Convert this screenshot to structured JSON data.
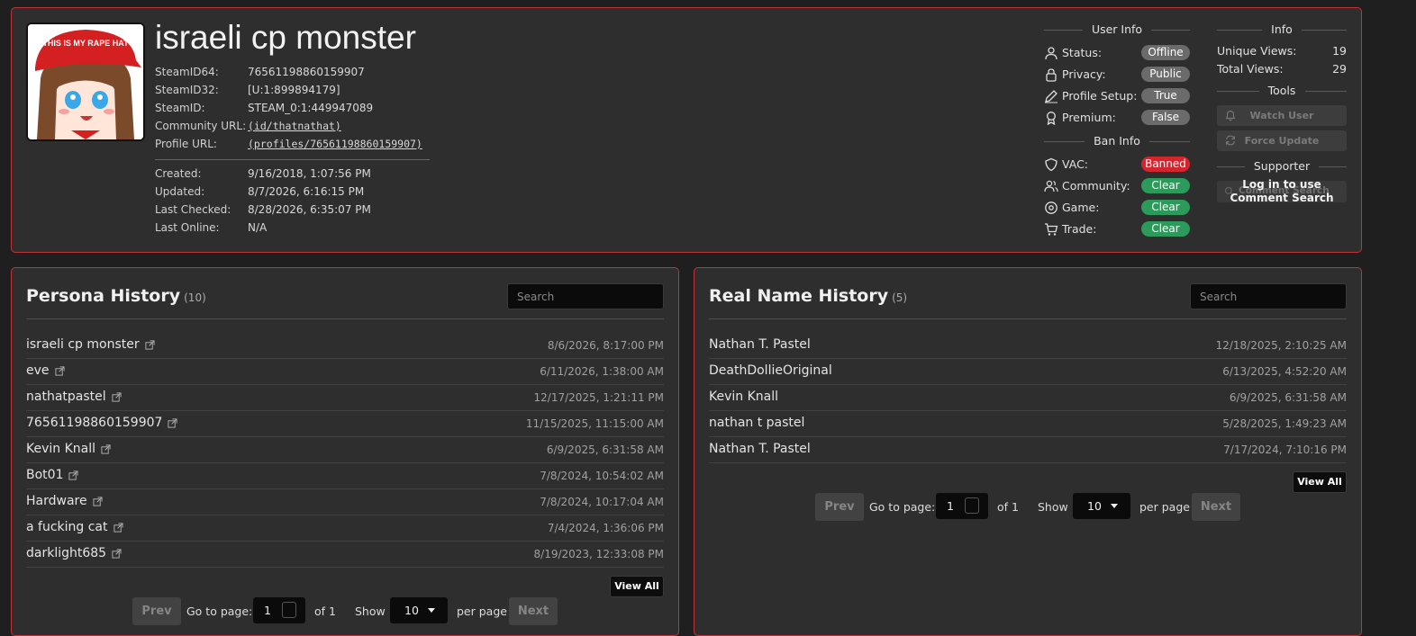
{
  "profile": {
    "name": "israeli cp monster",
    "avatar_text": "THIS IS MY RAPE HAT",
    "fields": [
      {
        "key": "SteamID64:",
        "value": "76561198860159907"
      },
      {
        "key": "SteamID32:",
        "value": "[U:1:899894179]"
      },
      {
        "key": "SteamID:",
        "value": "STEAM_0:1:449947089"
      },
      {
        "key": "Community URL:",
        "value": "(id/thatnathat)"
      },
      {
        "key": "Profile URL:",
        "value": "(profiles/76561198860159907)"
      }
    ],
    "dates": [
      {
        "key": "Created:",
        "value": "9/16/2018, 1:07:56 PM"
      },
      {
        "key": "Updated:",
        "value": "8/7/2026, 6:16:15 PM"
      },
      {
        "key": "Last Checked:",
        "value": "8/28/2026, 6:35:07 PM"
      },
      {
        "key": "Last Online:",
        "value": "N/A"
      }
    ]
  },
  "user_info": {
    "heading": "User Info",
    "rows": [
      {
        "label": "Status:",
        "value": "Offline",
        "icon": "user-icon",
        "color": "#6b6b6b"
      },
      {
        "label": "Privacy:",
        "value": "Public",
        "icon": "lock-icon",
        "color": "#6b6b6b"
      },
      {
        "label": "Profile Setup:",
        "value": "True",
        "icon": "pencil-icon",
        "color": "#6b6b6b"
      },
      {
        "label": "Premium:",
        "value": "False",
        "icon": "award-icon",
        "color": "#6b6b6b"
      }
    ]
  },
  "ban_info": {
    "heading": "Ban Info",
    "rows": [
      {
        "label": "VAC:",
        "value": "Banned",
        "icon": "shield-icon",
        "color": "#d4252e"
      },
      {
        "label": "Community:",
        "value": "Clear",
        "icon": "users-icon",
        "color": "#2b9a5a"
      },
      {
        "label": "Game:",
        "value": "Clear",
        "icon": "disc-icon",
        "color": "#2b9a5a"
      },
      {
        "label": "Trade:",
        "value": "Clear",
        "icon": "cart-icon",
        "color": "#2b9a5a"
      }
    ]
  },
  "info": {
    "heading": "Info",
    "unique_views_label": "Unique Views:",
    "unique_views": "19",
    "total_views_label": "Total Views:",
    "total_views": "29"
  },
  "tools": {
    "heading": "Tools",
    "watch_label": "Watch User",
    "update_label": "Force Update"
  },
  "supporter": {
    "heading": "Supporter",
    "ghost_label": "Comment Search",
    "login_text": "Log in to use Comment Search"
  },
  "persona": {
    "title": "Persona History",
    "count": "(10)",
    "search_placeholder": "Search",
    "rows": [
      {
        "name": "israeli cp monster",
        "date": "8/6/2026, 8:17:00 PM"
      },
      {
        "name": "eve",
        "date": "6/11/2026, 1:38:00 AM"
      },
      {
        "name": "nathatpastel",
        "date": "12/17/2025, 1:21:11 PM"
      },
      {
        "name": "76561198860159907",
        "date": "11/15/2025, 11:15:00 AM"
      },
      {
        "name": "Kevin Knall",
        "date": "6/9/2025, 6:31:58 AM"
      },
      {
        "name": "Bot01",
        "date": "7/8/2024, 10:54:02 AM"
      },
      {
        "name": "Hardware",
        "date": "7/8/2024, 10:17:04 AM"
      },
      {
        "name": "a fucking cat",
        "date": "7/4/2024, 1:36:06 PM"
      },
      {
        "name": "darklight685",
        "date": "8/19/2023, 12:33:08 PM"
      }
    ],
    "view_all": "View All",
    "pager": {
      "prev": "Prev",
      "goto": "Go to page:",
      "page": "1",
      "of": "of 1",
      "show": "Show",
      "per": "10",
      "per_page": "per page",
      "next": "Next"
    }
  },
  "realname": {
    "title": "Real Name History",
    "count": "(5)",
    "search_placeholder": "Search",
    "rows": [
      {
        "name": "Nathan T. Pastel",
        "date": "12/18/2025, 2:10:25 AM"
      },
      {
        "name": "DeathDollieOriginal",
        "date": "6/13/2025, 4:52:20 AM"
      },
      {
        "name": "Kevin Knall",
        "date": "6/9/2025, 6:31:58 AM"
      },
      {
        "name": "nathan t pastel",
        "date": "5/28/2025, 1:49:23 AM"
      },
      {
        "name": "Nathan T. Pastel",
        "date": "7/17/2024, 7:10:16 PM"
      }
    ],
    "view_all": "View All",
    "pager": {
      "prev": "Prev",
      "goto": "Go to page:",
      "page": "1",
      "of": "of 1",
      "show": "Show",
      "per": "10",
      "per_page": "per page",
      "next": "Next"
    }
  }
}
